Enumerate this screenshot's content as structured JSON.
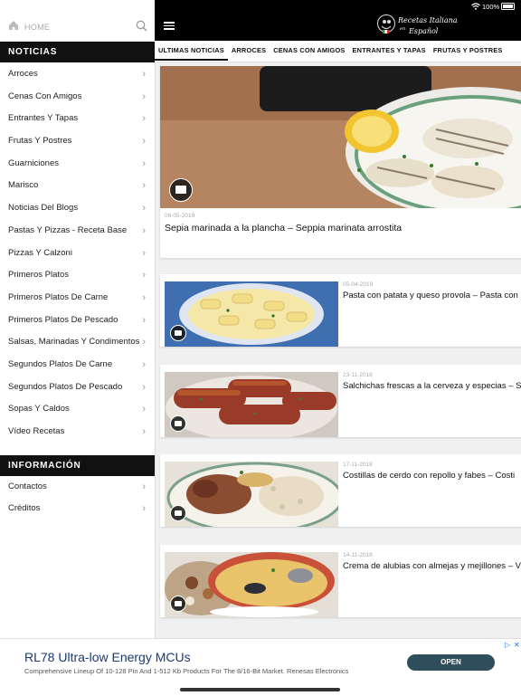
{
  "status_bar": {
    "battery": "100%"
  },
  "header": {
    "home_label": "HOME",
    "logo_text_line1": "Recetas Italianas",
    "logo_text_line2": "en",
    "logo_text_line3": "Español"
  },
  "sidebar": {
    "section_news": "NOTICIAS",
    "categories": [
      {
        "label": "Arroces"
      },
      {
        "label": "Cenas Con Amigos"
      },
      {
        "label": "Entrantes Y Tapas"
      },
      {
        "label": "Frutas Y Postres"
      },
      {
        "label": "Guarniciones"
      },
      {
        "label": "Marisco"
      },
      {
        "label": "Noticias Del Blogs"
      },
      {
        "label": "Pastas Y Pizzas - Receta Base"
      },
      {
        "label": "Pizzas Y Calzoni"
      },
      {
        "label": "Primeros Platos"
      },
      {
        "label": "Primeros Platos De Carne"
      },
      {
        "label": "Primeros Platos De Pescado"
      },
      {
        "label": "Salsas, Marinadas Y Condimentos"
      },
      {
        "label": "Segundos Platos De Carne"
      },
      {
        "label": "Segundos Platos De Pescado"
      },
      {
        "label": "Sopas Y Caldos"
      },
      {
        "label": "Vídeo Recetas"
      }
    ],
    "section_info": "INFORMACIÓN",
    "info_items": [
      {
        "label": "Contactos"
      },
      {
        "label": "Créditos"
      }
    ]
  },
  "tabs": [
    {
      "label": "ULTIMAS NOTICIAS",
      "active": true
    },
    {
      "label": "ARROCES"
    },
    {
      "label": "CENAS CON AMIGOS"
    },
    {
      "label": "ENTRANTES Y TAPAS"
    },
    {
      "label": "FRUTAS Y POSTRES"
    }
  ],
  "featured": {
    "date": "06-05-2019",
    "title": "Sepia marinada a la plancha – Seppia marinata arrostita"
  },
  "posts": [
    {
      "date": "05-04-2019",
      "title": "Pasta con patata y queso provola – Pasta con"
    },
    {
      "date": "23-11-2018",
      "title": "Salchichas frescas a la cerveza y especias – S"
    },
    {
      "date": "17-11-2018",
      "title": "Costillas de cerdo con repollo y fabes – Costi"
    },
    {
      "date": "14-11-2018",
      "title": "Crema de alubias con almejas y mejillones – V"
    }
  ],
  "ad": {
    "title": "RL78 Ultra-low Energy MCUs",
    "description": "Comprehensive Lineup Of 10-128 Pin And 1-512 Kb Products For The 8/16-Bit Market.",
    "advertiser": "Renesas Electronics",
    "button": "OPEN"
  },
  "icons": {
    "home": "home-icon",
    "search": "search-icon",
    "menu": "hamburger-menu-icon",
    "chevron": "chevron-right-icon",
    "gallery": "gallery-icon",
    "wifi": "wifi-icon",
    "battery": "battery-icon"
  },
  "colors": {
    "header_bg": "#000000",
    "ad_button": "#2f4d5a",
    "ad_title": "#1a3a6e"
  }
}
